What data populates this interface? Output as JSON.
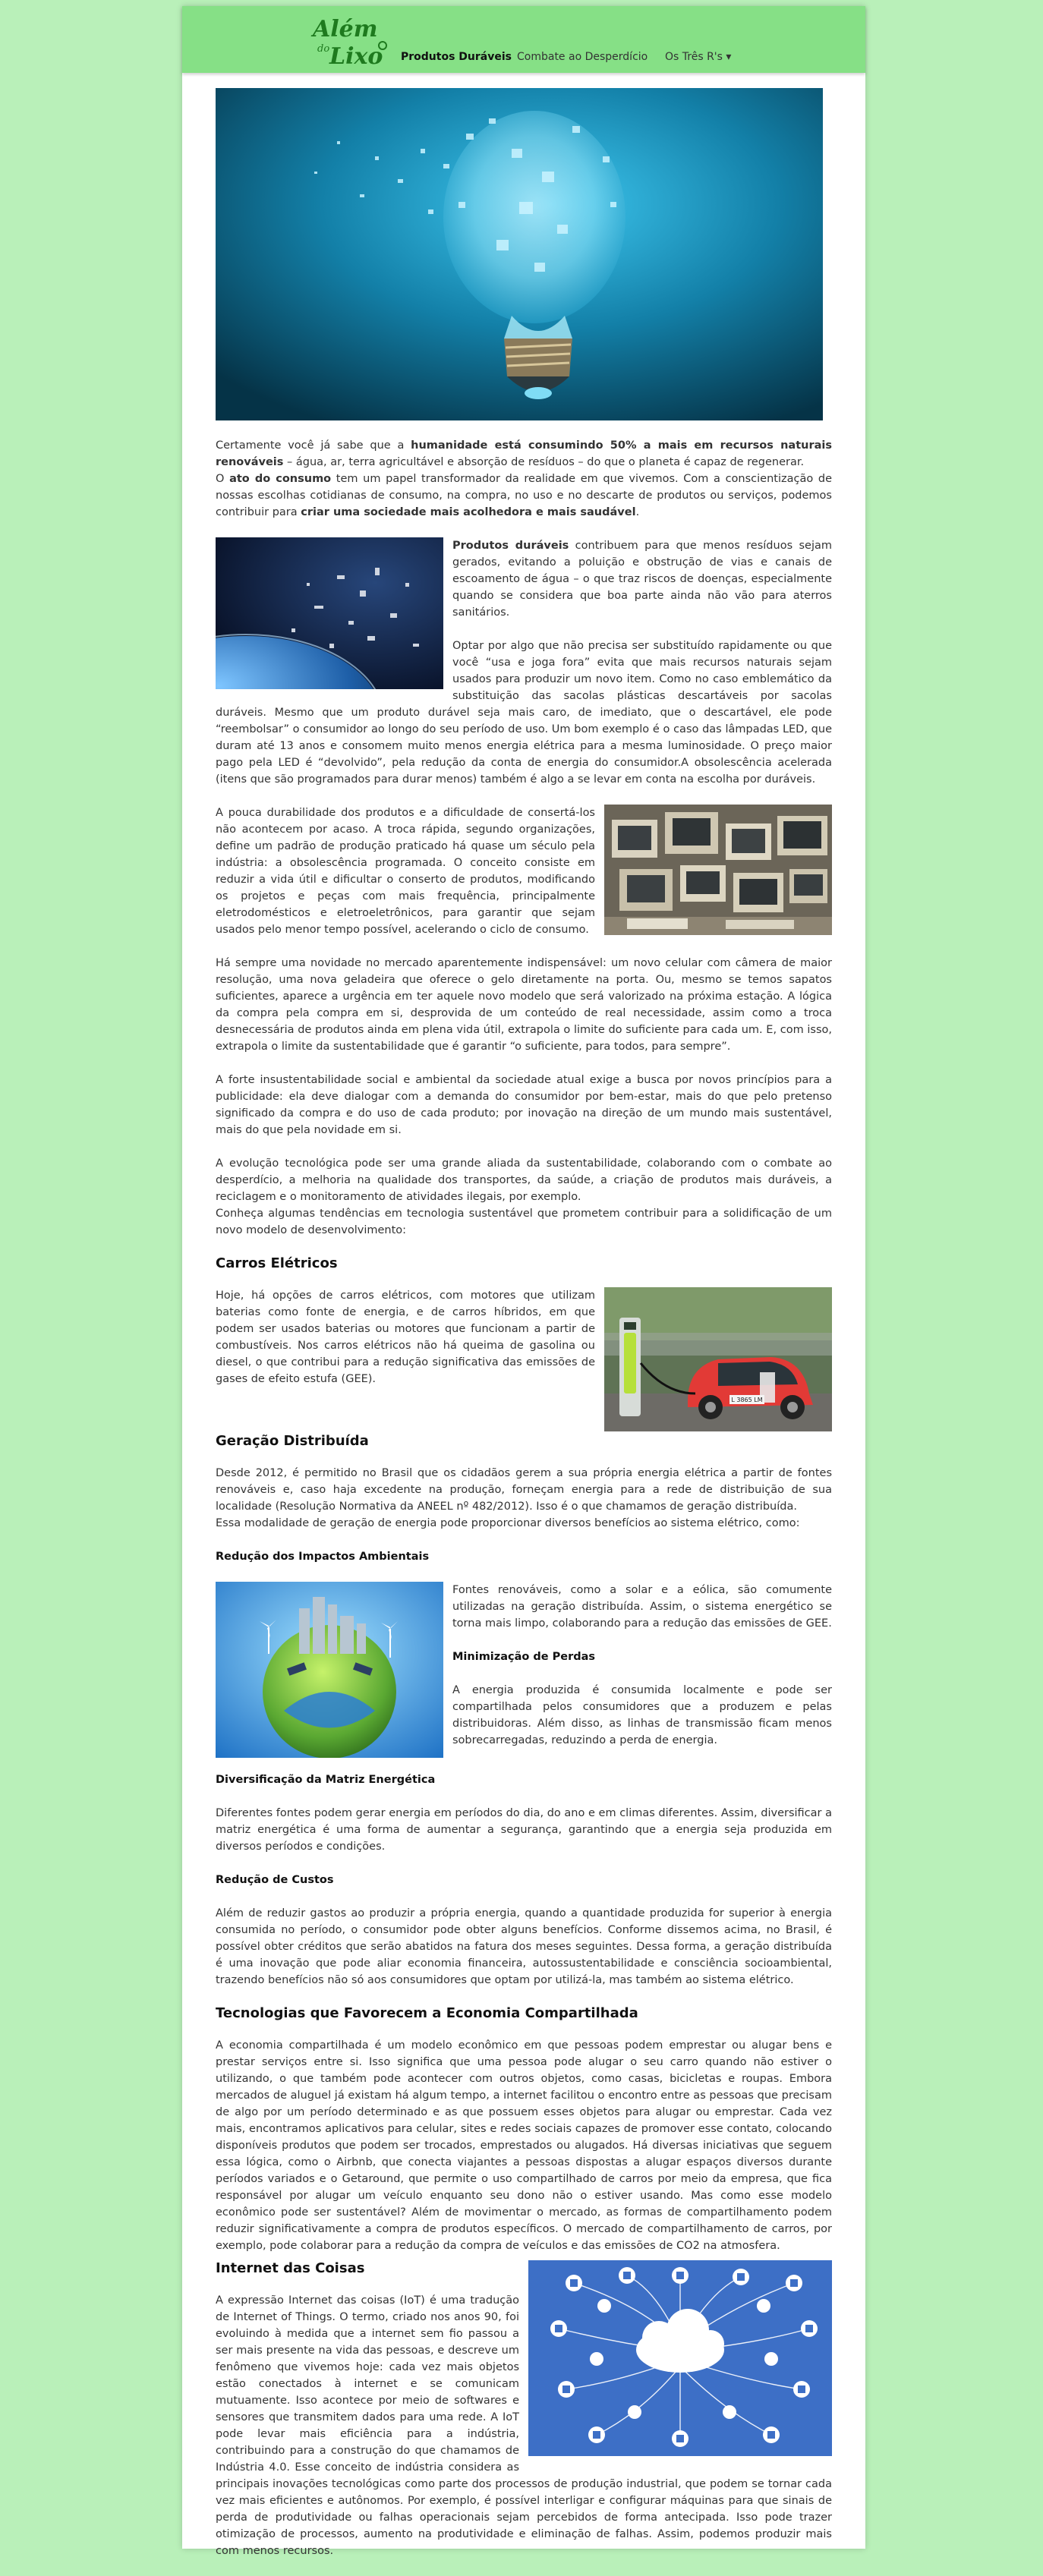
{
  "nav": {
    "logo_line1": "Além",
    "logo_line2": "do",
    "logo_line3": "Lixo",
    "items": [
      "Produtos Duráveis",
      "Combate ao Desperdício",
      "Os Três R's"
    ],
    "dropdown_caret": "▾"
  },
  "colors": {
    "background": "#b9f0b9",
    "navbar": "#86e086",
    "logo": "#1e7a1e"
  },
  "intro": {
    "p1_a": "Certamente você já sabe que a ",
    "p1_b": "humanidade está consumindo 50% a mais em recursos naturais renováveis",
    "p1_c": " – água, ar, terra agricultável e absorção de resíduos – do que o planeta é capaz de regenerar.",
    "p2_a": "O ",
    "p2_b": "ato do consumo",
    "p2_c": " tem um papel transformador da realidade em que vivemos. Com a conscientização de nossas escolhas cotidianas de consumo, na compra, no uso e no descarte de produtos ou serviços, podemos contribuir para ",
    "p2_d": "criar uma sociedade mais acolhedora e mais saudável",
    "p2_e": "."
  },
  "duraveis": {
    "p1_a": "Produtos duráveis",
    "p1_b": " contribuem para que menos resíduos sejam gerados, evitando a poluição e obstrução de vias e canais de escoamento de água – o que traz riscos de doenças, especialmente quando se considera que boa parte ainda não vão para aterros sanitários.",
    "p2": "Optar por algo que não precisa ser substituído rapidamente ou que você “usa e joga fora” evita que mais recursos naturais sejam usados para produzir um novo item. Como no caso emblemático da substituição das sacolas plásticas descartáveis por sacolas duráveis. Mesmo que um produto durável seja mais caro, de imediato, que o descartável, ele pode “reembolsar” o consumidor ao longo do seu período de uso. Um bom exemplo é o caso das lâmpadas LED, que duram até 13 anos e consomem muito menos energia elétrica para a mesma luminosidade. O preço maior pago pela LED é “devolvido”, pela redução da conta de energia do consumidor.A obsolescência acelerada (itens que são programados para durar menos) também é algo a se levar em conta na escolha por duráveis."
  },
  "obsolescencia": {
    "p1": "A pouca durabilidade dos produtos e a dificuldade de consertá-los não acontecem por acaso. A troca rápida, segundo organizações, define um padrão de produção praticado há quase um século pela indústria: a obsolescência programada. O conceito consiste em reduzir a vida útil e dificultar o conserto de produtos, modificando os projetos e peças com mais frequência, principalmente eletrodomésticos e eletroeletrônicos, para garantir que sejam usados pelo menor tempo possível, acelerando o ciclo de consumo.",
    "p2": "Há sempre uma novidade no mercado aparentemente indispensável: um novo celular com câmera de maior resolução, uma nova geladeira que oferece o gelo diretamente na porta. Ou, mesmo se temos sapatos suficientes, aparece a urgência em ter aquele novo modelo que será valorizado na próxima estação. A lógica da compra pela compra em si, desprovida de um conteúdo de real necessidade, assim como a troca desnecessária de produtos ainda em plena vida útil, extrapola o limite do suficiente para cada um. E, com isso, extrapola o limite da sustentabilidade que é garantir “o suficiente, para todos, para sempre”.",
    "p3": "A forte insustentabilidade social e ambiental da sociedade atual exige a busca por novos princípios para a publicidade: ela deve dialogar com a demanda do consumidor por bem-estar, mais do que pelo pretenso significado da compra e do uso de cada produto; por inovação na direção de um mundo mais sustentável, mais do que pela novidade em si.",
    "p4": "A evolução tecnológica pode ser uma grande aliada da sustentabilidade, colaborando com o combate ao desperdício, a melhoria na qualidade dos transportes, da saúde, a criação de produtos mais duráveis, a reciclagem e o monitoramento de atividades ilegais, por exemplo.",
    "p5": "Conheça algumas tendências em tecnologia sustentável que prometem contribuir para a solidificação de um novo modelo de desenvolvimento:"
  },
  "carros": {
    "title": "Carros Elétricos",
    "p1": "Hoje, há opções de carros elétricos, com motores que utilizam baterias como fonte de energia, e de carros híbridos, em que podem ser usados baterias ou motores que funcionam a partir de combustíveis. Nos carros elétricos não há queima de gasolina ou diesel, o que contribui para a redução significativa das emissões de gases de efeito estufa (GEE).",
    "plate": "L 3865 LM"
  },
  "geracao": {
    "title": "Geração Distribuída",
    "p1": "Desde 2012, é permitido no Brasil que os cidadãos gerem a sua própria energia elétrica a partir de fontes renováveis e, caso haja excedente na produção, forneçam energia para a rede de distribuição de sua localidade (Resolução Normativa da ANEEL nº 482/2012). Isso é o que chamamos de geração distribuída.",
    "p2": "Essa modalidade de geração de energia pode proporcionar diversos benefícios ao sistema elétrico, como:",
    "h_impactos": "Redução dos Impactos Ambientais",
    "p_impactos": "Fontes renováveis, como a solar e a eólica, são comumente utilizadas na geração distribuída. Assim, o sistema energético se torna mais limpo, colaborando para a redução das emissões de GEE.",
    "h_perdas": "Minimização de Perdas",
    "p_perdas": "A energia produzida é consumida localmente e pode ser compartilhada pelos consumidores que a produzem e pelas distribuidoras. Além disso, as linhas de transmissão ficam menos sobrecarregadas, reduzindo a perda de energia.",
    "h_matriz": "Diversificação da Matriz Energética",
    "p_matriz": "Diferentes fontes podem gerar energia em períodos do dia, do ano e em climas diferentes. Assim, diversificar a matriz energética é uma forma de aumentar a segurança, garantindo que a energia seja produzida em diversos períodos e condições.",
    "h_custos": "Redução de Custos",
    "p_custos": "Além de reduzir gastos ao produzir a própria energia, quando a quantidade produzida for superior à energia consumida no período, o consumidor pode obter alguns benefícios. Conforme dissemos acima, no Brasil, é possível obter créditos que serão abatidos na fatura dos meses seguintes. Dessa forma, a geração distribuída é uma inovação que pode aliar economia financeira, autossustentabilidade e consciência socioambiental, trazendo benefícios não só aos consumidores que optam por utilizá-la, mas também ao sistema elétrico."
  },
  "compartilhada": {
    "title": "Tecnologias que Favorecem a Economia Compartilhada",
    "p1": "A economia compartilhada é um modelo econômico em que pessoas podem emprestar ou alugar bens e prestar serviços entre si. Isso significa que uma pessoa pode alugar o seu carro quando não estiver o utilizando, o que também pode acontecer com outros objetos, como casas, bicicletas e roupas. Embora mercados de aluguel já existam há algum tempo, a internet facilitou o encontro entre as pessoas que precisam de algo por um período determinado e as que possuem esses objetos para alugar ou emprestar. Cada vez mais, encontramos aplicativos para celular, sites e redes sociais capazes de promover esse contato, colocando disponíveis produtos que podem ser trocados, emprestados ou alugados. Há diversas iniciativas que seguem essa lógica, como o Airbnb, que conecta viajantes a pessoas dispostas a alugar espaços diversos durante períodos variados e o Getaround, que permite o uso compartilhado de carros por meio da empresa, que fica responsável por alugar um veículo enquanto seu dono não o estiver usando. Mas como esse modelo econômico pode ser sustentável? Além de movimentar o mercado, as formas de compartilhamento podem reduzir significativamente a compra de produtos específicos. O mercado de compartilhamento de carros, por exemplo, pode colaborar para a redução da compra de veículos e das emissões de CO2 na atmosfera."
  },
  "iot": {
    "title": "Internet das Coisas",
    "p1": "A expressão Internet das coisas (IoT) é uma tradução de Internet of Things. O termo, criado nos anos 90, foi evoluindo à medida que a internet sem fio passou a ser mais presente na vida das pessoas, e descreve um fenômeno que vivemos hoje: cada vez mais objetos estão conectados à internet e se comunicam mutuamente. Isso acontece por meio de softwares e sensores que transmitem dados para uma rede. A IoT pode levar mais eficiência para a indústria, contribuindo para a construção do que chamamos de Indústria 4.0. Esse conceito de indústria considera as principais inovações tecnológicas como parte dos processos de produção industrial, que podem se tornar cada vez mais eficientes e autônomos. Por exemplo, é possível interligar e configurar máquinas para que sinais de perda de produtividade ou falhas operacionais sejam percebidos de forma antecipada. Isso pode trazer otimização de processos, aumento na produtividade e eliminação de falhas. Assim, podemos produzir mais com menos recursos."
  }
}
